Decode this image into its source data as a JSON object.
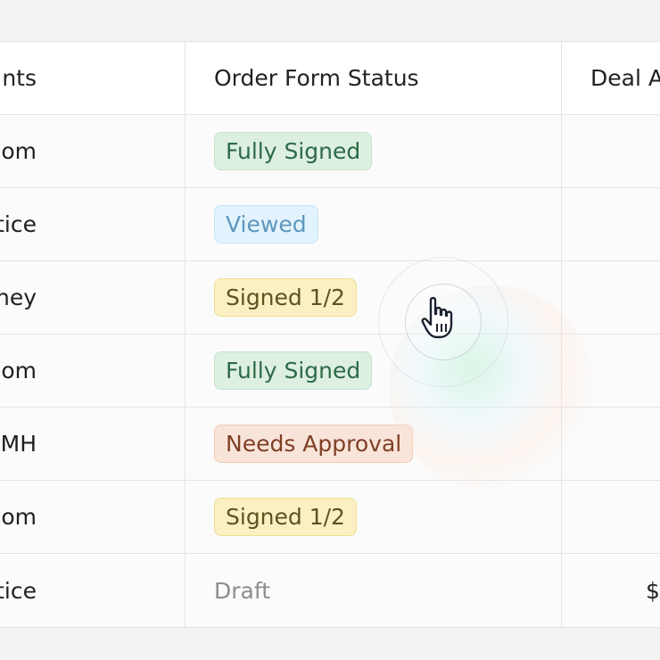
{
  "table": {
    "headers": {
      "col1": "nts",
      "col2": "Order Form Status",
      "col3": "Deal A"
    },
    "rows": [
      {
        "name": "om",
        "status": "Fully Signed",
        "amount": ""
      },
      {
        "name": "ttice",
        "status": "Viewed",
        "amount": ""
      },
      {
        "name": "sney",
        "status": "Signed 1/2",
        "amount": ""
      },
      {
        "name": "tercom",
        "status": "Fully Signed",
        "amount": ""
      },
      {
        "name": "MH",
        "status": "Needs Approval",
        "amount": ""
      },
      {
        "name": "om",
        "status": "Signed 1/2",
        "amount": ""
      },
      {
        "name": "ttice",
        "status": "Draft",
        "amount": "$"
      }
    ]
  },
  "colors": {
    "fully_signed": "#2e6a45",
    "viewed": "#5d97be",
    "signed_half": "#5d5220",
    "needs_approval": "#7f3f24",
    "draft": "#8d8d8d"
  },
  "cursor": {
    "icon": "hand-pointer-icon"
  }
}
